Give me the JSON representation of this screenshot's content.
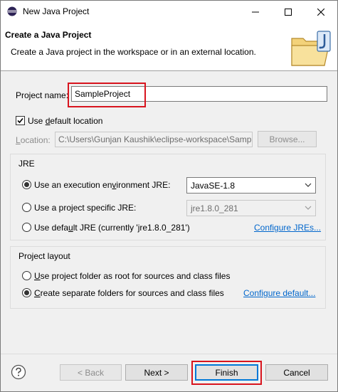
{
  "window": {
    "title": "New Java Project",
    "icon": "eclipse-icon"
  },
  "header": {
    "title": "Create a Java Project",
    "description": "Create a Java project in the workspace or in an external location.",
    "image": "java-project-folder-icon"
  },
  "project_name": {
    "label": "Project name:",
    "value": "SampleProject"
  },
  "use_default_location": {
    "label_pre": "Use ",
    "label_mn": "d",
    "label_post": "efault location",
    "checked": true
  },
  "location": {
    "label_mn": "L",
    "label_post": "ocation:",
    "value": "C:\\Users\\Gunjan Kaushik\\eclipse-workspace\\Sampl",
    "browse_label": "Browse..."
  },
  "jre": {
    "group_title": "JRE",
    "options": [
      {
        "pre": "Use an execution en",
        "mn": "v",
        "post": "ironment JRE:",
        "selected": true,
        "combo": "JavaSE-1.8"
      },
      {
        "pre": "Use a project specific JRE:",
        "mn": "",
        "post": "",
        "selected": false,
        "combo": "jre1.8.0_281"
      },
      {
        "pre": "Use defa",
        "mn": "u",
        "post": "lt JRE (currently 'jre1.8.0_281')",
        "selected": false,
        "link": "Configure JREs..."
      }
    ]
  },
  "project_layout": {
    "group_title": "Project layout",
    "options": [
      {
        "pre": "",
        "mn": "U",
        "post": "se project folder as root for sources and class files",
        "selected": false
      },
      {
        "pre": "",
        "mn": "C",
        "post": "reate separate folders for sources and class files",
        "selected": true,
        "link": "Configure default..."
      }
    ]
  },
  "footer": {
    "back_label": "< Back",
    "next_label": "Next >",
    "finish_label": "Finish",
    "cancel_label": "Cancel"
  },
  "colors": {
    "highlight": "#d8141e",
    "link": "#0066cc",
    "default_button_border": "#0078d7"
  }
}
